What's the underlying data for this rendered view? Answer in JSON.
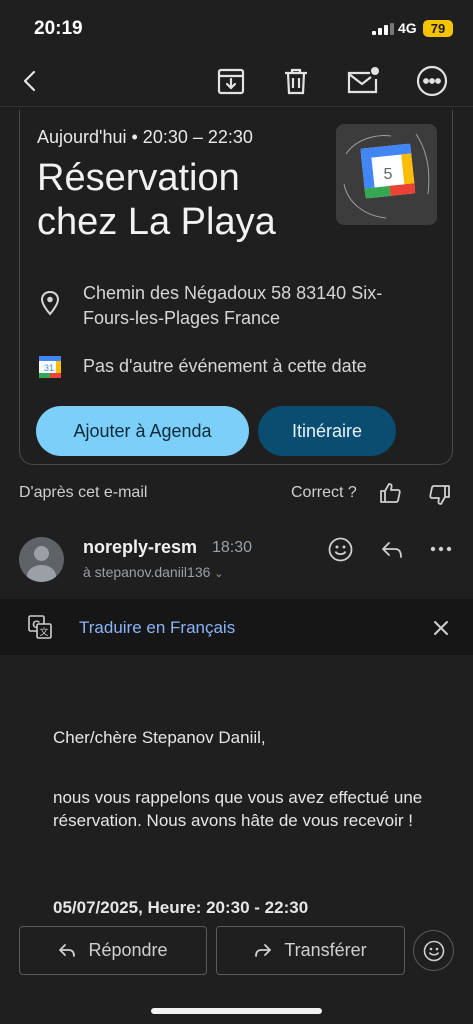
{
  "status": {
    "time": "20:19",
    "network": "4G",
    "battery": "79"
  },
  "event": {
    "date": "Aujourd'hui • 20:30 – 22:30",
    "title": "Réservation chez La Playa",
    "calendar_day": "5",
    "location": "Chemin des Négadoux 58 83140 Six-Fours-les-Plages France",
    "availability": "Pas d'autre événement à cette date",
    "add_button": "Ajouter à Agenda",
    "route_button": "Itinéraire"
  },
  "feedback": {
    "source": "D'après cet e-mail",
    "question": "Correct ?"
  },
  "sender": {
    "name": "noreply-resm",
    "time": "18:30",
    "to": "à stepanov.daniil136"
  },
  "translate": {
    "label": "Traduire en Français"
  },
  "body": {
    "greeting": "Cher/chère Stepanov Daniil,",
    "paragraph": "nous vous rappelons que vous avez effectué une réservation. Nous avons hâte de vous recevoir !",
    "datetime": "05/07/2025, Heure: 20:30 - 22:30"
  },
  "footer": {
    "reply": "Répondre",
    "forward": "Transférer"
  },
  "icons": {
    "back": "back-arrow-icon",
    "archive": "archive-icon",
    "delete": "trash-icon",
    "unread": "mark-unread-icon",
    "more": "more-icon",
    "location": "location-pin-icon",
    "calendar": "calendar-icon",
    "like": "thumbs-up-icon",
    "dislike": "thumbs-down-icon",
    "emoji": "emoji-icon",
    "reply": "reply-icon",
    "translate": "translate-icon",
    "close": "close-icon"
  },
  "colors": {
    "accent_light": "#7ccff8",
    "accent_dark": "#0a4d70",
    "link": "#8ab4f8",
    "battery": "#f4c400"
  }
}
